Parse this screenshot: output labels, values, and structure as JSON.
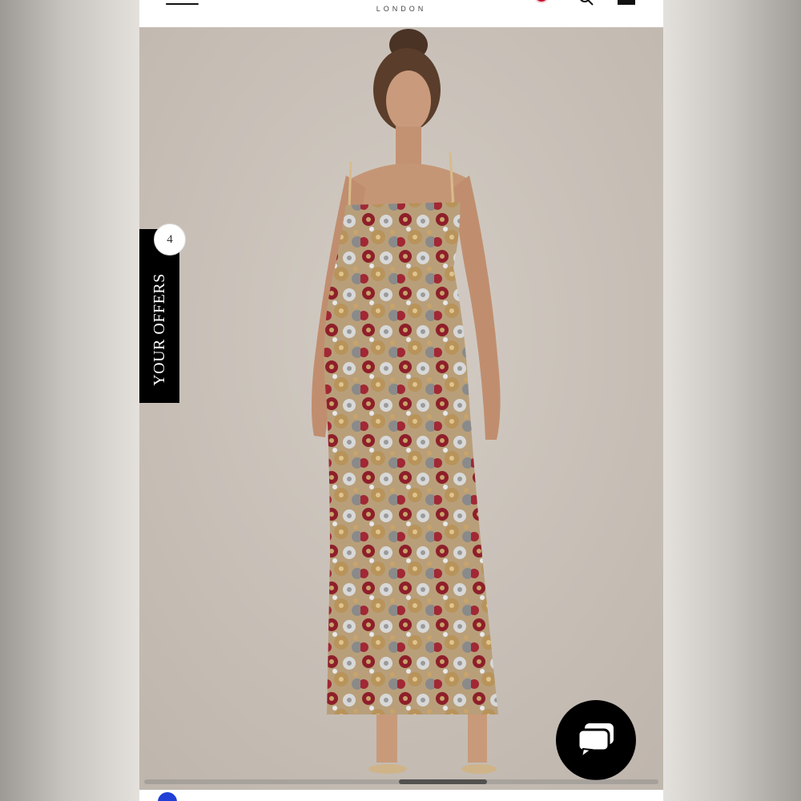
{
  "header": {
    "brand_sub": "LONDON",
    "icons": [
      "menu-icon",
      "flag-icon",
      "search-icon",
      "bag-icon"
    ]
  },
  "offers": {
    "label": "YOUR OFFERS",
    "count": "4"
  },
  "chat": {
    "icon": "chat-bubbles-icon"
  },
  "colors": {
    "tab_background": "#000000",
    "chat_background": "#000000",
    "hero_background": "#cdc5bd",
    "flag_red": "#c8102e",
    "accent_blue": "#1f3fd6"
  }
}
